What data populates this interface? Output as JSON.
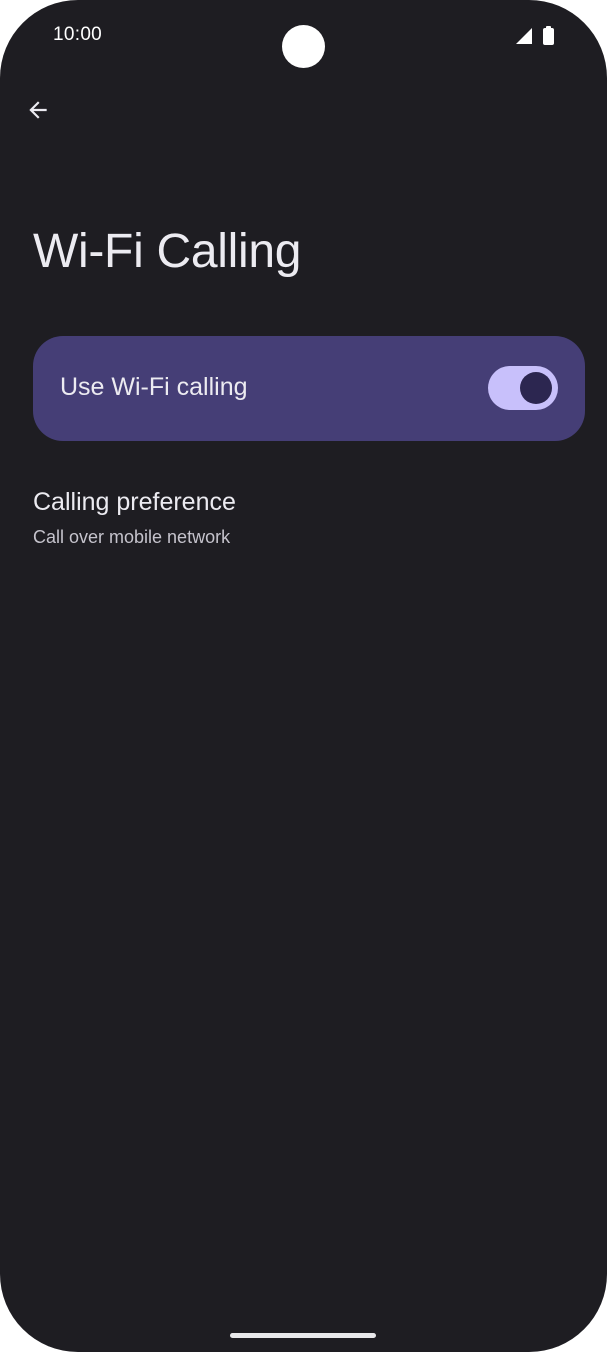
{
  "status_bar": {
    "time": "10:00"
  },
  "header": {
    "back_icon": "arrow-back-icon",
    "title": "Wi-Fi Calling"
  },
  "main_switch": {
    "label": "Use Wi-Fi calling",
    "enabled": true
  },
  "preferences": [
    {
      "title": "Calling preference",
      "summary": "Call over mobile network"
    }
  ],
  "colors": {
    "background": "#1e1d22",
    "card": "#453e76",
    "toggle_track": "#c8c0fb",
    "toggle_thumb": "#2c2650"
  }
}
